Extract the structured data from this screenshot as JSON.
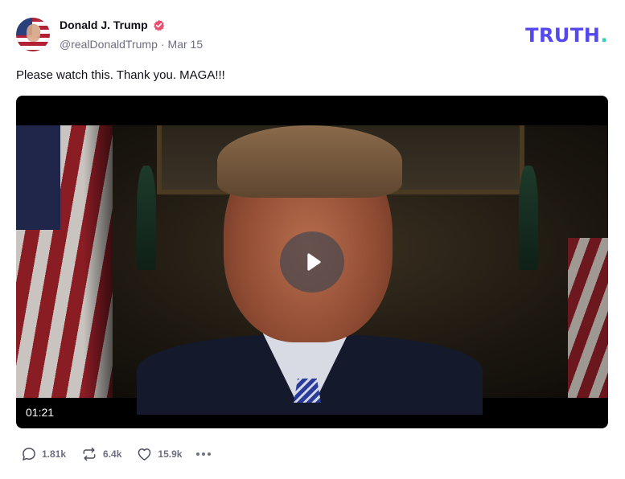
{
  "author": {
    "display_name": "Donald J. Trump",
    "handle": "@realDonaldTrump",
    "separator": "·",
    "date": "Mar 15",
    "verified_color": "#e8506e"
  },
  "brand": {
    "logo_text": "TRUTH",
    "logo_dot": ".",
    "logo_color": "#5448ee",
    "dot_color": "#2ad4b6"
  },
  "post": {
    "text": "Please watch this. Thank you. MAGA!!!"
  },
  "video": {
    "duration": "01:21",
    "play_icon": "play-icon"
  },
  "actions": {
    "replies": {
      "icon": "reply-icon",
      "count": "1.81k"
    },
    "retruths": {
      "icon": "retruth-icon",
      "count": "6.4k"
    },
    "likes": {
      "icon": "heart-icon",
      "count": "15.9k"
    },
    "more": {
      "icon": "more-icon"
    }
  }
}
